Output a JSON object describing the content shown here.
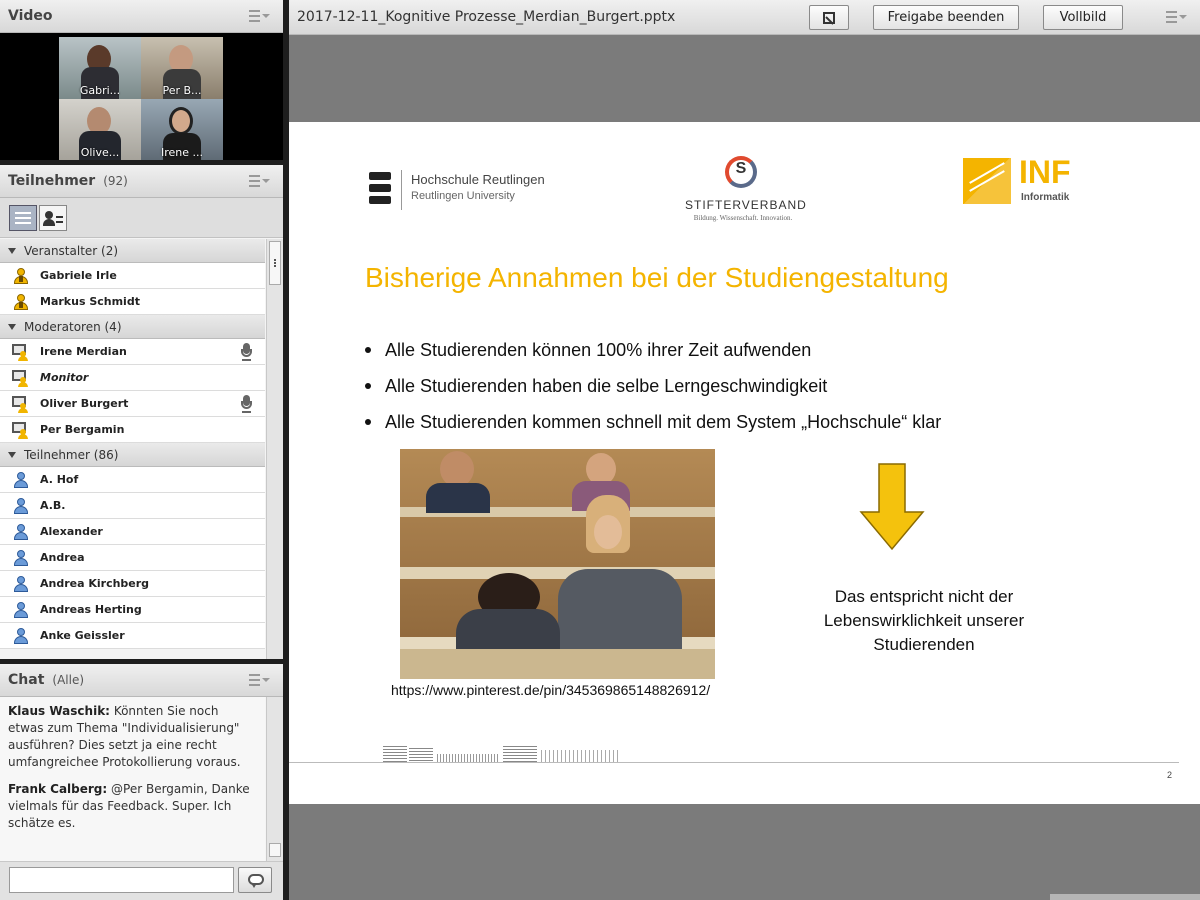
{
  "video": {
    "title": "Video",
    "tiles": [
      {
        "name": "Gabri..."
      },
      {
        "name": "Per B..."
      },
      {
        "name": "Olive..."
      },
      {
        "name": "Irene ..."
      }
    ]
  },
  "attendees": {
    "title": "Teilnehmer",
    "count": "(92)",
    "groups": [
      {
        "label": "Veranstalter (2)",
        "members": [
          {
            "name": "Gabriele Irle",
            "role": "host"
          },
          {
            "name": "Markus Schmidt",
            "role": "host"
          }
        ]
      },
      {
        "label": "Moderatoren (4)",
        "members": [
          {
            "name": "Irene Merdian",
            "role": "presenter",
            "mic": true
          },
          {
            "name": "Monitor",
            "role": "presenter"
          },
          {
            "name": "Oliver Burgert",
            "role": "presenter",
            "mic": true
          },
          {
            "name": "Per Bergamin",
            "role": "presenter"
          }
        ]
      },
      {
        "label": "Teilnehmer (86)",
        "members": [
          {
            "name": "A. Hof",
            "role": "participant"
          },
          {
            "name": "A.B.",
            "role": "participant"
          },
          {
            "name": "Alexander",
            "role": "participant"
          },
          {
            "name": "Andrea",
            "role": "participant"
          },
          {
            "name": "Andrea Kirchberg",
            "role": "participant"
          },
          {
            "name": "Andreas Herting",
            "role": "participant"
          },
          {
            "name": "Anke Geissler",
            "role": "participant"
          }
        ]
      }
    ]
  },
  "chat": {
    "title": "Chat",
    "scope": "(Alle)",
    "messages": [
      {
        "author": "Klaus Waschik:",
        "text": "Könnten Sie noch etwas zum Thema \"Individualisierung\" ausführen? Dies setzt ja eine recht umfangreichee Protokollierung voraus."
      },
      {
        "author": "Frank Calberg:",
        "text": "@Per Bergamin, Danke vielmals für das Feedback. Super. Ich schätze es."
      }
    ]
  },
  "share": {
    "filename": "2017-12-11_Kognitive Prozesse_Merdian_Burgert.pptx",
    "stop_label": "Freigabe beenden",
    "fullscreen_label": "Vollbild"
  },
  "slide": {
    "logo_hsr_line1": "Hochschule Reutlingen",
    "logo_hsr_line2": "Reutlingen University",
    "logo_stifter": "STIFTERVERBAND",
    "logo_stifter_sub": "Bildung. Wissenschaft. Innovation.",
    "logo_stifter_mark": "S",
    "logo_inf": "INF",
    "logo_inf_sub": "Informatik",
    "title": "Bisherige Annahmen bei der Studiengestaltung",
    "bullets": [
      "Alle Studierenden können 100% ihrer Zeit aufwenden",
      "Alle Studierenden haben die selbe Lerngeschwindigkeit",
      "Alle Studierenden kommen schnell mit dem System „Hochschule“ klar"
    ],
    "note": "Das entspricht nicht der Lebenswirklichkeit unserer Studierenden",
    "url": "https://www.pinterest.de/pin/345369865148826912/",
    "page": "2",
    "accent": "#f4b400"
  }
}
